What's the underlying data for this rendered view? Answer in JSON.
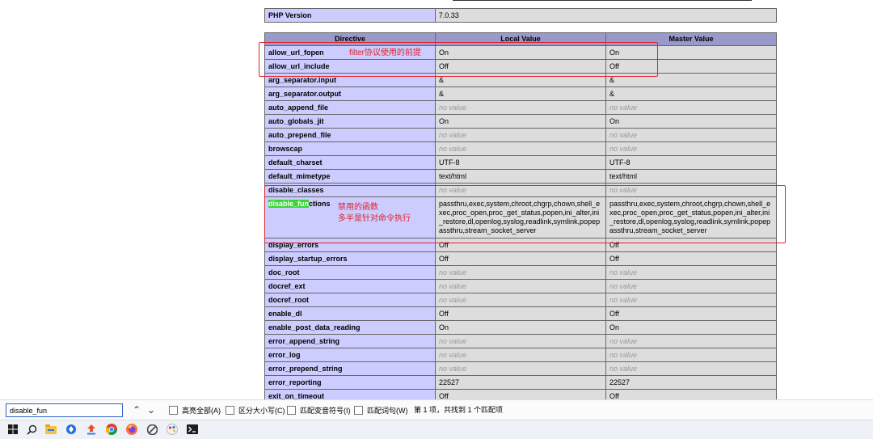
{
  "php_version": {
    "label": "PHP Version",
    "value": "7.0.33"
  },
  "directives": {
    "headers": [
      "Directive",
      "Local Value",
      "Master Value"
    ],
    "rows": [
      {
        "name": "allow_url_fopen",
        "local": "On",
        "master": "On"
      },
      {
        "name": "allow_url_include",
        "local": "Off",
        "master": "Off"
      },
      {
        "name": "arg_separator.input",
        "local": "&",
        "master": "&"
      },
      {
        "name": "arg_separator.output",
        "local": "&",
        "master": "&"
      },
      {
        "name": "auto_append_file",
        "local": "no value",
        "master": "no value"
      },
      {
        "name": "auto_globals_jit",
        "local": "On",
        "master": "On"
      },
      {
        "name": "auto_prepend_file",
        "local": "no value",
        "master": "no value"
      },
      {
        "name": "browscap",
        "local": "no value",
        "master": "no value"
      },
      {
        "name": "default_charset",
        "local": "UTF-8",
        "master": "UTF-8"
      },
      {
        "name": "default_mimetype",
        "local": "text/html",
        "master": "text/html"
      },
      {
        "name": "disable_classes",
        "local": "no value",
        "master": "no value"
      },
      {
        "name": "disable_functions",
        "highlight": "disable_fun",
        "rest": "ctions",
        "local": "passthru,exec,system,chroot,chgrp,chown,shell_exec,proc_open,proc_get_status,popen,ini_alter,ini_restore,dl,openlog,syslog,readlink,symlink,popepassthru,stream_socket_server",
        "master": "passthru,exec,system,chroot,chgrp,chown,shell_exec,proc_open,proc_get_status,popen,ini_alter,ini_restore,dl,openlog,syslog,readlink,symlink,popepassthru,stream_socket_server"
      },
      {
        "name": "display_errors",
        "local": "Off",
        "master": "Off"
      },
      {
        "name": "display_startup_errors",
        "local": "Off",
        "master": "Off"
      },
      {
        "name": "doc_root",
        "local": "no value",
        "master": "no value"
      },
      {
        "name": "docref_ext",
        "local": "no value",
        "master": "no value"
      },
      {
        "name": "docref_root",
        "local": "no value",
        "master": "no value"
      },
      {
        "name": "enable_dl",
        "local": "Off",
        "master": "Off"
      },
      {
        "name": "enable_post_data_reading",
        "local": "On",
        "master": "On"
      },
      {
        "name": "error_append_string",
        "local": "no value",
        "master": "no value"
      },
      {
        "name": "error_log",
        "local": "no value",
        "master": "no value"
      },
      {
        "name": "error_prepend_string",
        "local": "no value",
        "master": "no value"
      },
      {
        "name": "error_reporting",
        "local": "22527",
        "master": "22527"
      },
      {
        "name": "exit_on_timeout",
        "local": "Off",
        "master": "Off"
      }
    ]
  },
  "annotations": {
    "filter_note": "filter协议使用的前提",
    "disable_note_1": "禁用的函数",
    "disable_note_2": "多半是针对命令执行"
  },
  "find_bar": {
    "query": "disable_fun",
    "prev_icon": "chevron-up-icon",
    "next_icon": "chevron-down-icon",
    "highlight_all": "高亮全部(A)",
    "match_case": "区分大小写(C)",
    "match_diacritics": "匹配变音符号(I)",
    "whole_words": "匹配词句(W)",
    "status": "第 1 项，共找到 1 个匹配项"
  },
  "taskbar": {
    "icons": [
      "windows-start-icon",
      "search-icon",
      "file-explorer-icon",
      "app-blue-icon",
      "app-upload-icon",
      "chrome-icon",
      "firefox-icon",
      "app-gray-icon",
      "app-paint-icon",
      "terminal-icon"
    ]
  },
  "colors": {
    "annotation_red": "#e0242b",
    "directive_bg": "#ccccff",
    "value_bg": "#dddddd",
    "header_bg": "#9999cc",
    "find_highlight": "#38d438"
  }
}
